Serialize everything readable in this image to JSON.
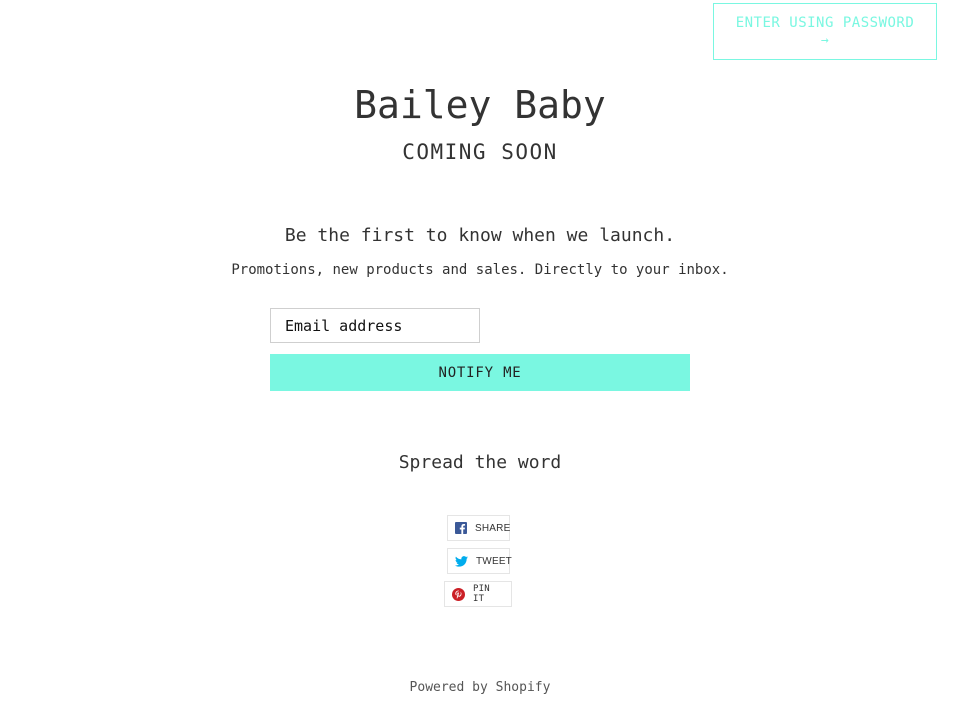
{
  "header": {
    "password_label": "ENTER USING PASSWORD",
    "password_arrow": "→"
  },
  "brand": {
    "name": "Bailey Baby",
    "tagline": "COMING SOON"
  },
  "signup": {
    "headline": "Be the first to know when we launch.",
    "subline": "Promotions, new products and sales. Directly to your inbox.",
    "email_placeholder": "Email address",
    "email_value": "",
    "button_label": "NOTIFY ME"
  },
  "social": {
    "heading": "Spread the word",
    "share_label": "SHARE",
    "share_icon": "facebook-icon",
    "tweet_label": "TWEET",
    "tweet_icon": "twitter-icon",
    "pin_label": "PIN IT",
    "pin_icon": "pinterest-icon"
  },
  "footer": {
    "powered_by": "Powered by Shopify"
  },
  "colors": {
    "accent": "#7af7e1",
    "text": "#333333",
    "facebook": "#3b5998",
    "twitter": "#00aced",
    "pinterest": "#cb2027"
  }
}
